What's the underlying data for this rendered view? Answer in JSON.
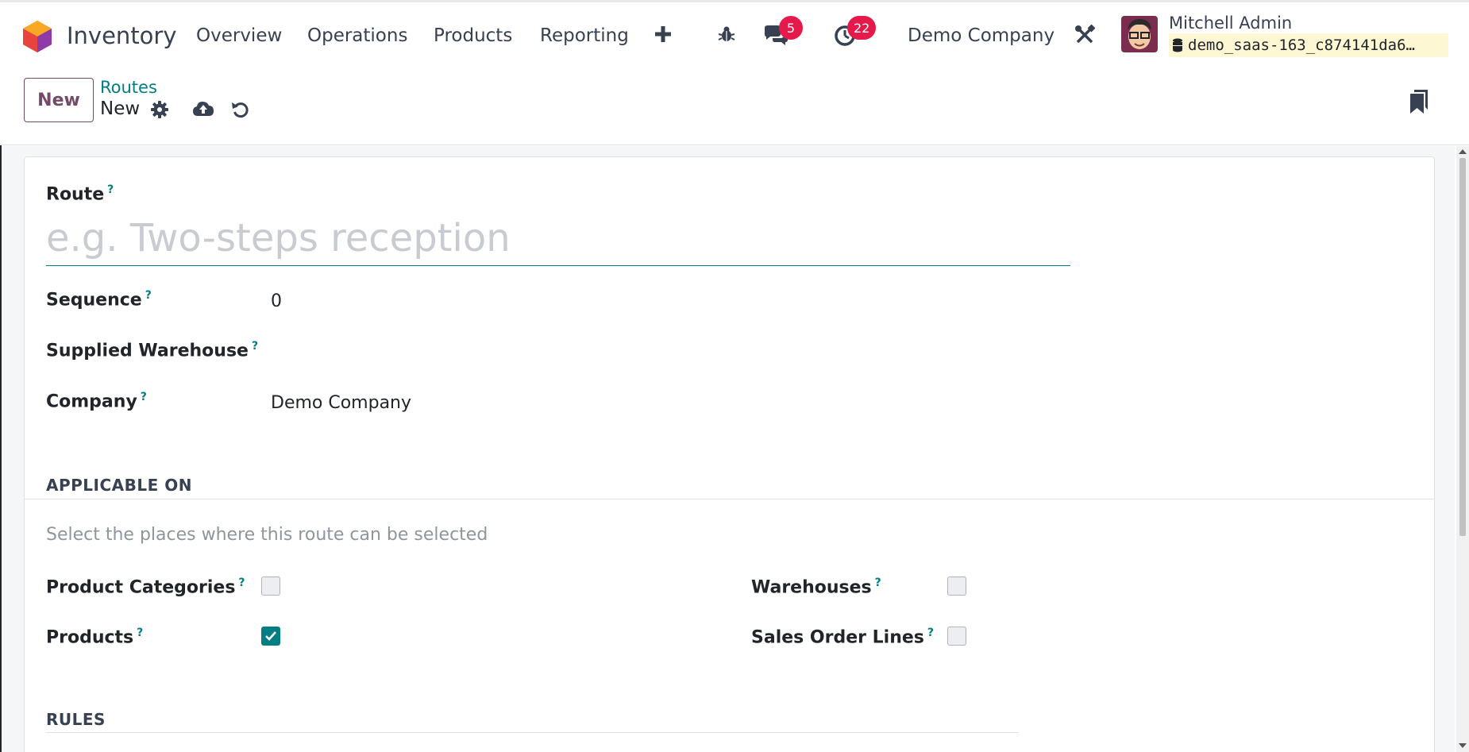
{
  "app": {
    "name": "Inventory"
  },
  "menu": [
    {
      "label": "Overview"
    },
    {
      "label": "Operations"
    },
    {
      "label": "Products"
    },
    {
      "label": "Reporting"
    }
  ],
  "systray": {
    "messages_count": "5",
    "activities_count": "22",
    "company": "Demo Company",
    "user_name": "Mitchell Admin",
    "database": "demo_saas-163_c874141da6…"
  },
  "control": {
    "new_label": "New",
    "breadcrumb": "Routes",
    "record_name": "New"
  },
  "form": {
    "route_label": "Route",
    "route_placeholder": "e.g. Two-steps reception",
    "sequence_label": "Sequence",
    "sequence_value": "0",
    "warehouse_label": "Supplied Warehouse",
    "company_label": "Company",
    "company_value": "Demo Company",
    "applicable_title": "APPLICABLE ON",
    "applicable_help": "Select the places where this route can be selected",
    "product_categories_label": "Product Categories",
    "products_label": "Products",
    "warehouses_label": "Warehouses",
    "sale_lines_label": "Sales Order Lines",
    "rules_title": "RULES",
    "help_mark": "?"
  },
  "checkboxes": {
    "product_categories": false,
    "products": true,
    "warehouses": false,
    "sale_lines": false
  },
  "colors": {
    "accent": "#017e84",
    "brand": "#714b67",
    "badge": "#e6194b"
  }
}
